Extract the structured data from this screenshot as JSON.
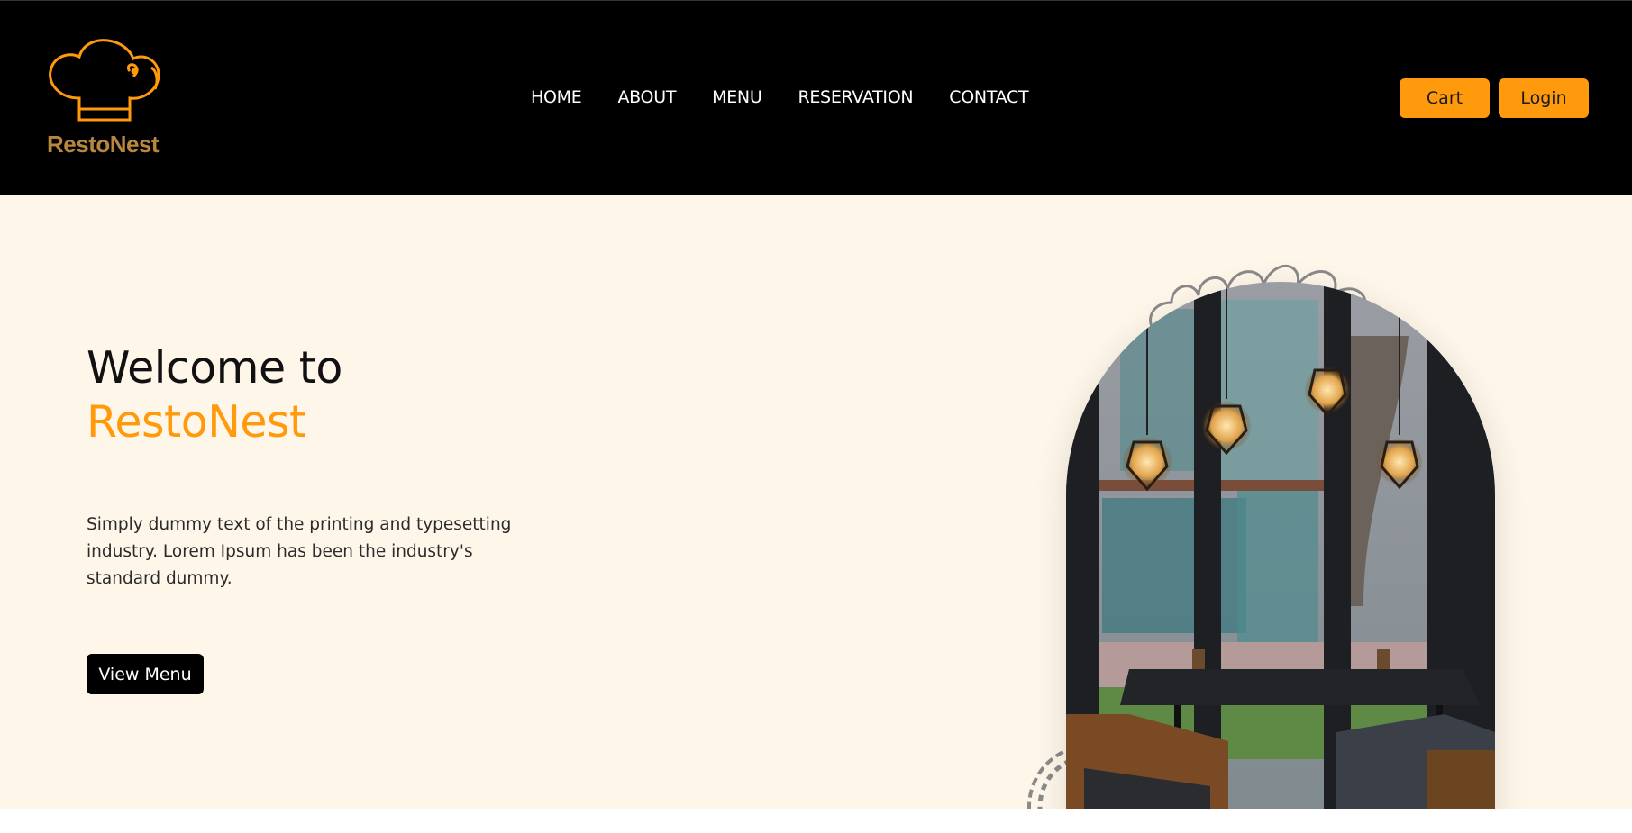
{
  "brand": {
    "name": "RestoNest",
    "logo_icon": "chef-hat-icon"
  },
  "nav": {
    "items": [
      "HOME",
      "ABOUT",
      "MENU",
      "RESERVATION",
      "CONTACT"
    ]
  },
  "actions": {
    "cart_label": "Cart",
    "login_label": "Login"
  },
  "hero": {
    "title_line1": "Welcome to",
    "title_line2": "RestoNest",
    "description": "Simply dummy text of the printing and typesetting industry. Lorem Ipsum has been the industry's standard dummy.",
    "cta_label": "View Menu",
    "image_subject": "restaurant-interior-pendant-lamps"
  },
  "colors": {
    "accent": "#ff9a0d",
    "navbar_bg": "#000000",
    "hero_bg": "#fff6ea",
    "logo_text": "#b8863c"
  }
}
